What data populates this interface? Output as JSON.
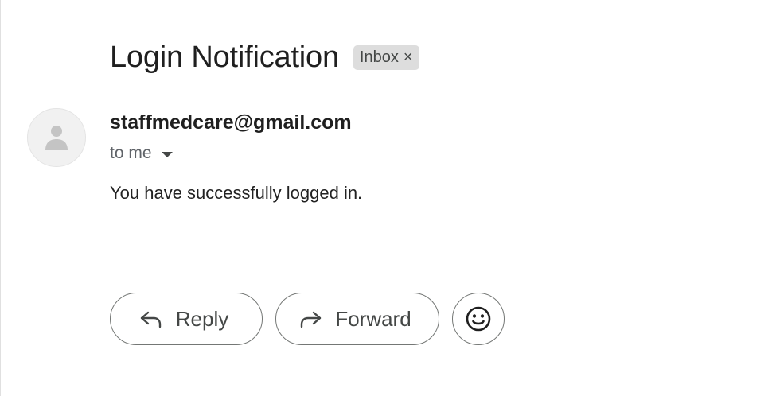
{
  "message": {
    "subject": "Login Notification",
    "label": "Inbox",
    "label_remove": "×",
    "sender": "staffmedcare@gmail.com",
    "recipient": "to me",
    "body": "You have successfully logged in."
  },
  "actions": {
    "reply_label": "Reply",
    "forward_label": "Forward"
  },
  "icons": {
    "avatar": "person-icon",
    "reply": "reply-arrow-icon",
    "forward": "forward-arrow-icon",
    "emoji": "smiley-icon",
    "details": "caret-down-icon"
  },
  "colors": {
    "text": "#1f1f1f",
    "secondary": "#5f6368",
    "chip_bg": "#dddddd",
    "button_border": "#747775"
  }
}
